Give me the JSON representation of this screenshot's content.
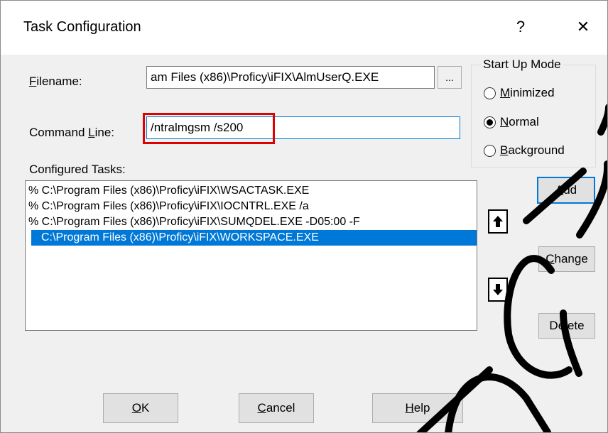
{
  "window": {
    "title": "Task Configuration",
    "help_glyph": "?",
    "close_glyph": "✕"
  },
  "filename": {
    "label_pre": "",
    "label_ul": "F",
    "label_post": "ilename:",
    "value": "am Files (x86)\\Proficy\\iFIX\\AlmUserQ.EXE",
    "browse_label": "..."
  },
  "command_line": {
    "label_pre": "Command ",
    "label_ul": "L",
    "label_post": "ine:",
    "value": "/ntralmgsm /s200"
  },
  "startup_mode": {
    "title": "Start Up Mode",
    "options": [
      {
        "pre": "",
        "ul": "M",
        "post": "inimized",
        "selected": false
      },
      {
        "pre": "",
        "ul": "N",
        "post": "ormal",
        "selected": true
      },
      {
        "pre": "",
        "ul": "B",
        "post": "ackground",
        "selected": false
      }
    ]
  },
  "configured_tasks": {
    "label": "Configured Tasks:",
    "items": [
      "% C:\\Program Files (x86)\\Proficy\\iFIX\\WSACTASK.EXE",
      "% C:\\Program Files (x86)\\Proficy\\iFIX\\IOCNTRL.EXE  /a",
      "% C:\\Program Files (x86)\\Proficy\\iFIX\\SUMQDEL.EXE  -D05:00 -F",
      "C:\\Program Files (x86)\\Proficy\\iFIX\\WORKSPACE.EXE"
    ],
    "selected_index": 3
  },
  "side_buttons": {
    "add": {
      "pre": "",
      "ul": "A",
      "post": "dd"
    },
    "change": {
      "pre": "",
      "ul": "C",
      "post": "hange"
    },
    "delete": {
      "pre": "De",
      "ul": "l",
      "post": "ete"
    }
  },
  "footer": {
    "ok": {
      "pre": "",
      "ul": "O",
      "post": "K"
    },
    "cancel": {
      "pre": "",
      "ul": "C",
      "post": "ancel"
    },
    "help": {
      "pre": "",
      "ul": "H",
      "post": "elp"
    }
  },
  "icons": {
    "move_up": "up-arrow-icon",
    "move_down": "down-arrow-icon"
  },
  "colors": {
    "selection": "#0078d7",
    "highlight": "#e00000",
    "watermark": "#000000"
  }
}
